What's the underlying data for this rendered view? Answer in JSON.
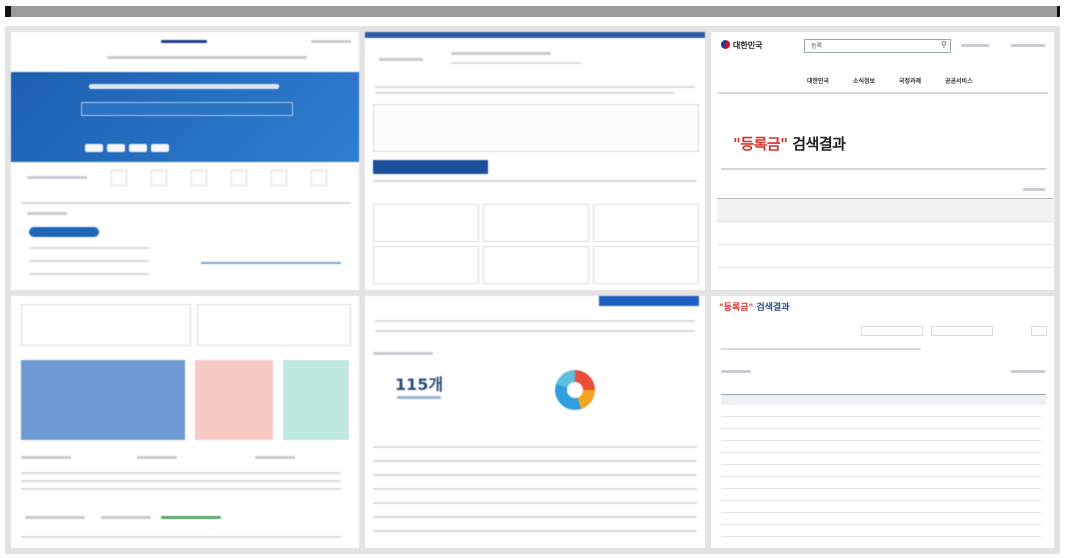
{
  "collage": {
    "grid_cols": 3,
    "grid_rows": 2
  },
  "panel_search_result": {
    "logo_text": "대한민국",
    "search_value": "등록",
    "nav_items": [
      "대한민국",
      "소식정보",
      "국정과제",
      "공공서비스"
    ],
    "result_title_quote": "\"등록금\"",
    "result_title_suffix": " 검색결과"
  },
  "panel_table_result": {
    "result_title_quote": "\"등록금\"",
    "result_title_suffix": " 검색결과"
  },
  "panel_statistics": {
    "count_value": "115개"
  },
  "colors": {
    "hero_blue": "#1e66b8",
    "accent_red": "#d6332b",
    "title_blue": "#2a4e8c",
    "panel_bg": "#e3e3e3",
    "topbar": "#9b9b9b"
  }
}
